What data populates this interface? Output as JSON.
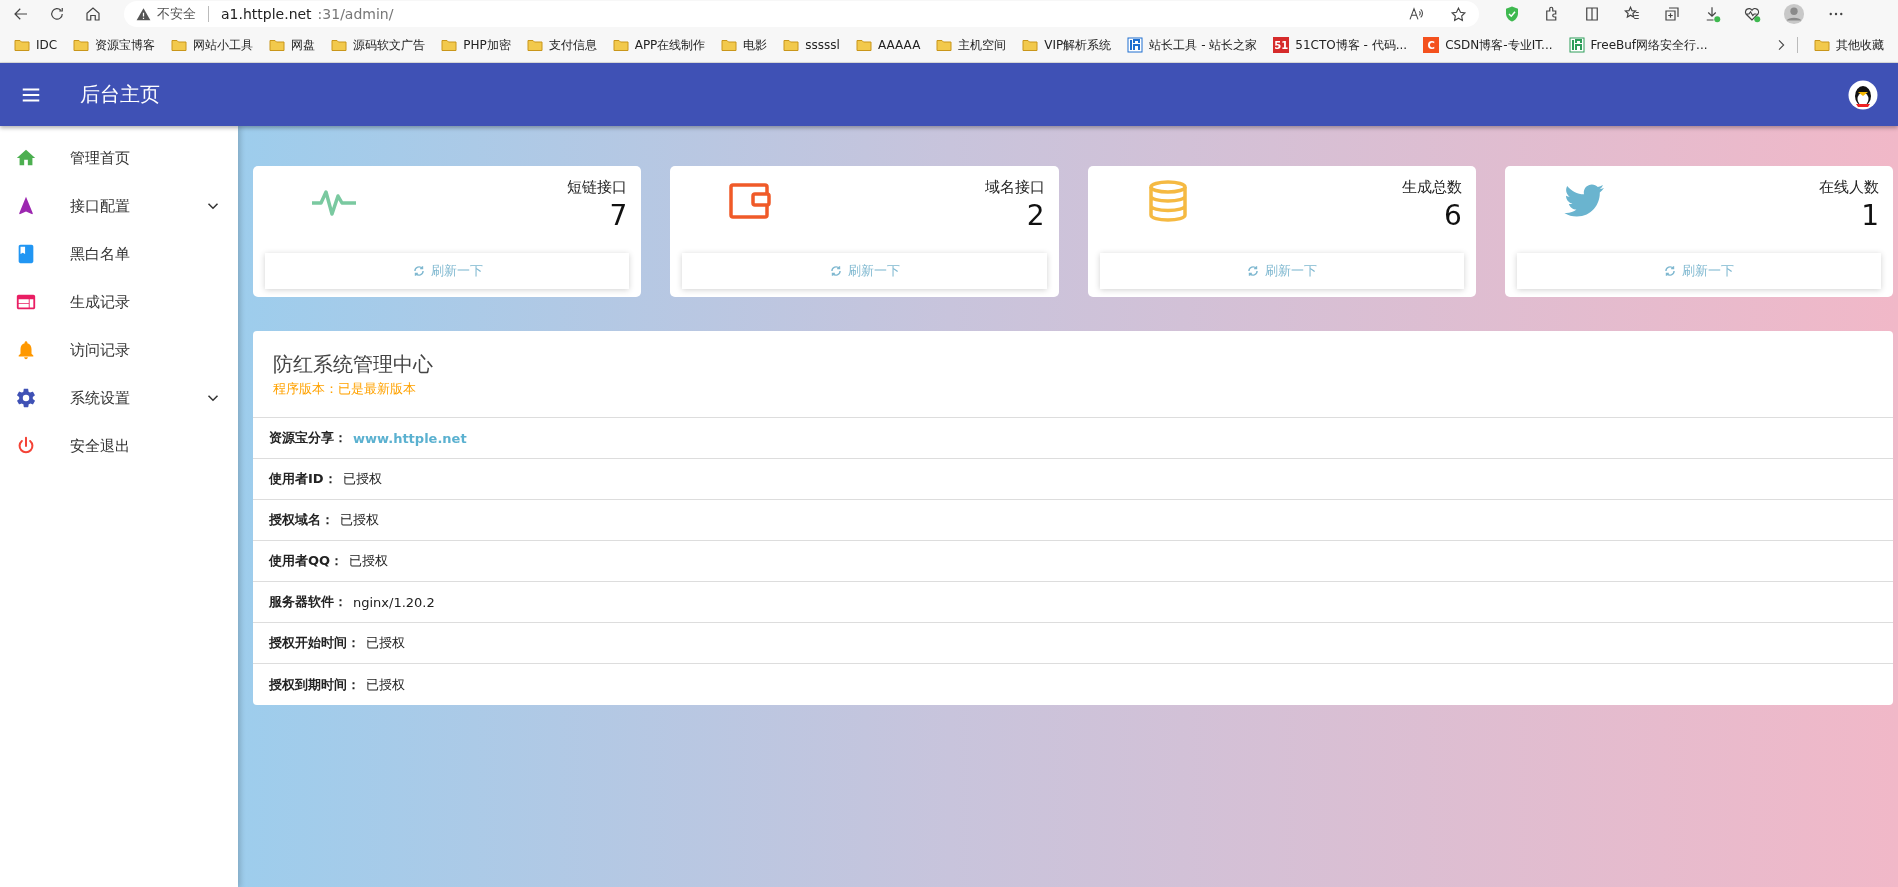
{
  "browser": {
    "security_label": "不安全",
    "url_host": "a1.httple.net",
    "url_path": ":31/admin/",
    "bookmarks": [
      {
        "kind": "folder",
        "label": "IDC"
      },
      {
        "kind": "folder",
        "label": "资源宝博客"
      },
      {
        "kind": "folder",
        "label": "网站小工具"
      },
      {
        "kind": "folder",
        "label": "网盘"
      },
      {
        "kind": "folder",
        "label": "源码软文广告"
      },
      {
        "kind": "folder",
        "label": "PHP加密"
      },
      {
        "kind": "folder",
        "label": "支付信息"
      },
      {
        "kind": "folder",
        "label": "APP在线制作"
      },
      {
        "kind": "folder",
        "label": "电影"
      },
      {
        "kind": "folder",
        "label": "sssssl"
      },
      {
        "kind": "folder",
        "label": "AAAAA"
      },
      {
        "kind": "folder",
        "label": "主机空间"
      },
      {
        "kind": "folder",
        "label": "VIP解析系统"
      },
      {
        "kind": "logo",
        "label": "站长工具 - 站长之家",
        "color": "#1e6fd0"
      },
      {
        "kind": "glyph",
        "label": "51CTO博客 - 代码...",
        "glyph": "51",
        "color": "#d62b2b"
      },
      {
        "kind": "glyph",
        "label": "CSDN博客-专业IT...",
        "glyph": "C",
        "color": "#f4511e"
      },
      {
        "kind": "logo",
        "label": "FreeBuf网络安全行...",
        "color": "#2e9e5b"
      }
    ],
    "other_bookmarks": "其他收藏"
  },
  "header": {
    "title": "后台主页"
  },
  "sidebar": {
    "items": [
      {
        "label": "管理首页",
        "expandable": false
      },
      {
        "label": "接口配置",
        "expandable": true
      },
      {
        "label": "黑白名单",
        "expandable": false
      },
      {
        "label": "生成记录",
        "expandable": false
      },
      {
        "label": "访问记录",
        "expandable": false
      },
      {
        "label": "系统设置",
        "expandable": true
      },
      {
        "label": "安全退出",
        "expandable": false
      }
    ]
  },
  "stats": [
    {
      "label": "短链接口",
      "value": "7",
      "button": "刷新一下"
    },
    {
      "label": "域名接口",
      "value": "2",
      "button": "刷新一下"
    },
    {
      "label": "生成总数",
      "value": "6",
      "button": "刷新一下"
    },
    {
      "label": "在线人数",
      "value": "1",
      "button": "刷新一下"
    }
  ],
  "panel": {
    "title": "防红系统管理中心",
    "version": "程序版本：已是最新版本",
    "rows": [
      {
        "label": "资源宝分享：",
        "value": "www.httple.net",
        "kind": "link"
      },
      {
        "label": "使用者ID：",
        "value": "已授权",
        "kind": "text"
      },
      {
        "label": "授权域名：",
        "value": "已授权",
        "kind": "text"
      },
      {
        "label": "使用者QQ：",
        "value": "已授权",
        "kind": "text"
      },
      {
        "label": "服务器软件：",
        "value": "nginx/1.20.2",
        "kind": "text"
      },
      {
        "label": "授权开始时间：",
        "value": "已授权",
        "kind": "text"
      },
      {
        "label": "授权到期时间：",
        "value": "已授权",
        "kind": "text"
      }
    ]
  }
}
